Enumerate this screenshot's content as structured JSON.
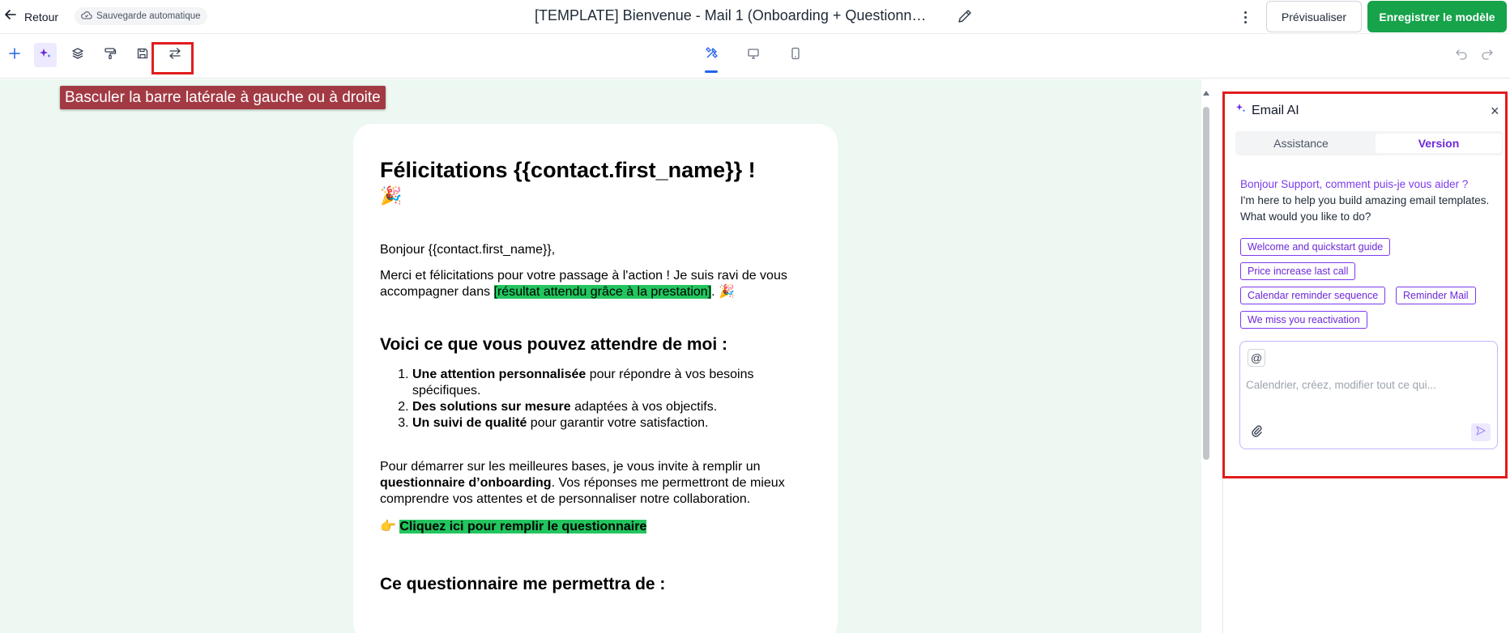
{
  "header": {
    "back_label": "Retour",
    "autosave_label": "Sauvegarde automatique",
    "title": "[TEMPLATE] Bienvenue - Mail 1 (Onboarding + Questionn…",
    "preview_label": "Prévisualiser",
    "save_label": "Enregistrer le modèle"
  },
  "toolbar": {
    "left_tools": [
      "plus-icon",
      "sparkles-icon",
      "layers-icon",
      "paint-roller-icon",
      "save-icon",
      "swap-arrows-icon"
    ],
    "view_modes": [
      "design-tools-icon",
      "desktop-icon",
      "mobile-icon"
    ],
    "history": [
      "undo-icon",
      "redo-icon"
    ]
  },
  "tooltip": {
    "text": "Basculer la barre latérale à gauche ou à droite"
  },
  "email": {
    "heading": "Félicitations {{contact.first_name}} !",
    "heading_emoji": "🎉",
    "greeting": "Bonjour {{contact.first_name}},",
    "para1_a": "Merci et félicitations pour votre passage à l'action ! Je suis ravi de vous accompagner dans ",
    "para1_highlight": "[résultat attendu grâce à la prestation]",
    "para1_b": ". 🎉",
    "section1_title": "Voici ce que vous pouvez attendre de moi :",
    "list": [
      {
        "bold": "Une attention personnalisée",
        "rest": " pour répondre à vos besoins spécifiques."
      },
      {
        "bold": "Des solutions sur mesure",
        "rest": " adaptées à vos objectifs."
      },
      {
        "bold": "Un suivi de qualité",
        "rest": " pour garantir votre satisfaction."
      }
    ],
    "para2_a": "Pour démarrer sur les meilleures bases, je vous invite à remplir un ",
    "para2_bold": "questionnaire d’onboarding",
    "para2_b": ". Vos réponses me permettront de mieux comprendre vos attentes et de personnaliser notre collaboration.",
    "cta_emoji": "👉",
    "cta_text": "Cliquez ici pour remplir le questionnaire",
    "section2_title": "Ce questionnaire me permettra de :"
  },
  "ai_panel": {
    "title": "Email AI",
    "tabs": [
      {
        "label": "Assistance",
        "selected": false
      },
      {
        "label": "Version",
        "selected": true
      }
    ],
    "greeting": "Bonjour Support, comment puis-je vous aider ?",
    "intro": "I'm here to help you build amazing email templates. What would you like to do?",
    "suggestions": [
      "Welcome and quickstart guide",
      "Price increase last call",
      "Calendar reminder sequence",
      "Reminder Mail",
      "We miss you reactivation"
    ],
    "at_symbol": "@",
    "input_placeholder": "Calendrier, créez, modifier tout ce qui..."
  },
  "colors": {
    "brand_green": "#16a34a",
    "accent_purple": "#7c3aed",
    "canvas_bg": "#ecf8f1",
    "highlight_green": "#22c55e",
    "annotation_red": "#e11d1d",
    "tooltip_bg": "#a23a44"
  }
}
